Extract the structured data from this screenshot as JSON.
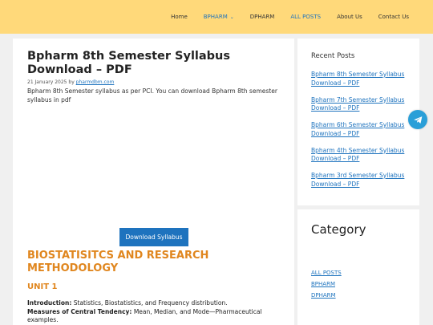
{
  "nav": {
    "items": [
      {
        "label": "Home"
      },
      {
        "label": "BPHARM"
      },
      {
        "label": "DPHARM"
      },
      {
        "label": "ALL POSTS"
      },
      {
        "label": "About Us"
      },
      {
        "label": "Contact Us"
      }
    ]
  },
  "post": {
    "title": "Bpharm 8th Semester Syllabus Download – PDF",
    "date": "21 January 2025",
    "by": "by",
    "author": "pharmdbm.com",
    "excerpt": "Bpharm 8th Semester syllabus as per PCI. You can download Bpharm 8th semester syllabus in pdf",
    "download_label": "Download Syllabus",
    "section_title": "BIOSTATISITCS AND RESEARCH METHODOLOGY",
    "unit_title": "UNIT 1",
    "intro_label": "Introduction:",
    "intro_text": " Statistics, Biostatistics, and Frequency distribution.",
    "measures_label": "Measures of Central Tendency:",
    "measures_text": " Mean, Median, and Mode—Pharmaceutical examples."
  },
  "sidebar": {
    "recent_heading": "Recent Posts",
    "recent_posts": [
      "Bpharm 8th Semester Syllabus Download – PDF",
      "Bpharm 7th Semester Syllabus Download – PDF",
      "Bpharm 6th Semester Syllabus Download – PDF",
      "Bpharm 4th Semester Syllabus Download – PDF",
      "Bpharm 3rd Semester Syllabus Download – PDF"
    ],
    "category_heading": "Category",
    "categories": [
      "ALL POSTS",
      "BPHARM",
      "DPHARM"
    ]
  },
  "colors": {
    "header_bg": "#ffd97a",
    "link": "#1e73be",
    "accent_orange": "#e0861e",
    "telegram": "#2a9fd8"
  },
  "icons": {
    "floating": "telegram-icon",
    "dropdown": "chevron-down-icon"
  }
}
